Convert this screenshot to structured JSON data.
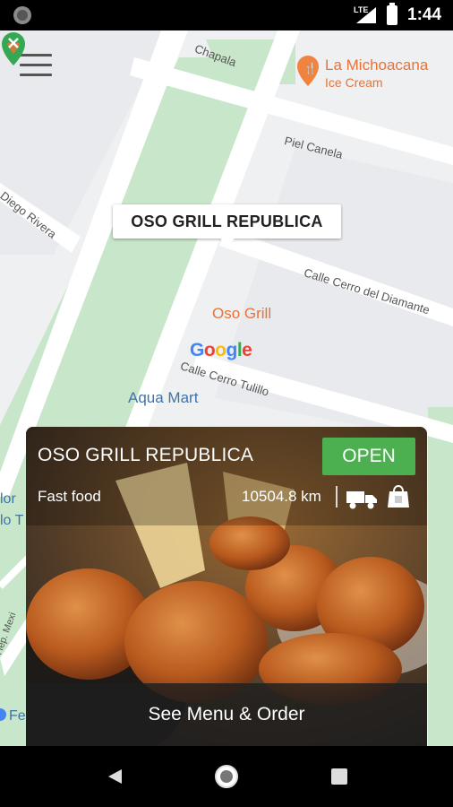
{
  "status_bar": {
    "network": "LTE",
    "time": "1:44"
  },
  "map": {
    "streets": [
      "Chapala",
      "Piel Canela",
      "Diego Rivera",
      "Calle Cerro del Diamante",
      "Calle Cerro Tulillo",
      "Hep. Mexi"
    ],
    "poi_icecream": {
      "name": "La Michoacana",
      "category": "Ice Cream"
    },
    "poi_restaurant": "Oso Grill",
    "aqua_mart": "Aqua Mart",
    "edge_text_1": "lor",
    "edge_text_2": "lo T",
    "edge_text_3": "Fe",
    "google_logo": "Google",
    "callout_title": "OSO GRILL REPUBLICA"
  },
  "card": {
    "title": "OSO GRILL REPUBLICA",
    "status": "OPEN",
    "category": "Fast food",
    "distance": "10504.8 km",
    "cta": "See Menu & Order"
  },
  "colors": {
    "open": "#4caf50",
    "park": "#c8e6c9",
    "accent": "#e8733a"
  },
  "icons": [
    "menu-icon",
    "restaurant-pin-icon",
    "ice-cream-pin-icon",
    "delivery-truck-icon",
    "shopping-bag-icon",
    "back-icon",
    "home-icon",
    "recents-icon"
  ]
}
